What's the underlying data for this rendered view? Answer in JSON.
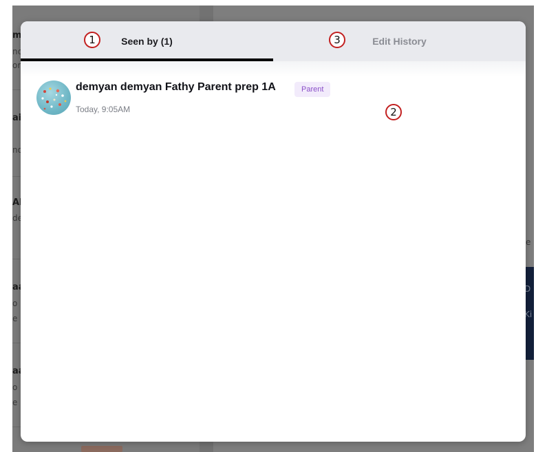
{
  "background": {
    "fragments": [
      "m",
      "nc",
      "or",
      "ai",
      "nd",
      "Al",
      "de",
      "aa",
      "o",
      "e",
      "aa",
      "o",
      "e",
      "e",
      "D",
      "Ki"
    ]
  },
  "modal": {
    "tabs": [
      {
        "label": "Seen by (1)",
        "active": true
      },
      {
        "label": "Edit History",
        "active": false
      }
    ],
    "seen_by": [
      {
        "name": "demyan demyan Fathy Parent prep 1A",
        "role": "Parent",
        "time": "Today, 9:05AM",
        "avatar": "balloons-sky-photo"
      }
    ]
  },
  "markers": [
    "1",
    "2",
    "3"
  ],
  "colors": {
    "overlay": "#7d7d7d",
    "tabbar": "#e9eaee",
    "active_indicator": "#000000",
    "role_badge_bg": "#f2ebfb",
    "role_badge_text": "#8a4fc8",
    "marker_ring": "#c21f1f"
  }
}
